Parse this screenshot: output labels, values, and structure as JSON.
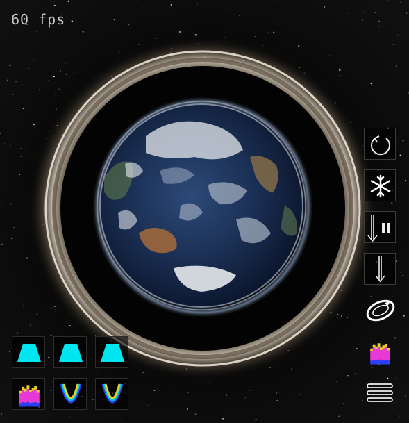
{
  "hud": {
    "fps_label": "60 fps"
  },
  "scene": {
    "subject": "earth-globe",
    "effect": "black-hole-lensing-ring"
  },
  "toolbar": {
    "items": [
      {
        "name": "rotate-button",
        "icon": "rotate-icon"
      },
      {
        "name": "freeze-button",
        "icon": "snowflake-icon"
      },
      {
        "name": "fall-pause-button",
        "icon": "down-arrow-pause-icon"
      },
      {
        "name": "fall-button",
        "icon": "down-arrow-icon"
      },
      {
        "name": "orbit-button",
        "icon": "orbit-ring-icon"
      },
      {
        "name": "spectrum-button",
        "icon": "spectrum-histogram-icon"
      },
      {
        "name": "menu-button",
        "icon": "hamburger-icon"
      }
    ]
  },
  "palette": {
    "colors": {
      "cyan": "#00e6f0",
      "magenta": "#e838d8",
      "yellow": "#e8d020",
      "blue": "#2a40ff"
    },
    "items": [
      {
        "name": "trapezoid-preset-1",
        "icon": "cyan-trapezoid-icon"
      },
      {
        "name": "trapezoid-preset-2",
        "icon": "cyan-trapezoid-icon"
      },
      {
        "name": "trapezoid-preset-3",
        "icon": "cyan-trapezoid-icon"
      },
      {
        "name": "spectrum-preset",
        "icon": "spectrum-histogram-icon"
      },
      {
        "name": "potential-well-preset-1",
        "icon": "potential-well-icon"
      },
      {
        "name": "potential-well-preset-2",
        "icon": "potential-well-icon"
      }
    ]
  }
}
